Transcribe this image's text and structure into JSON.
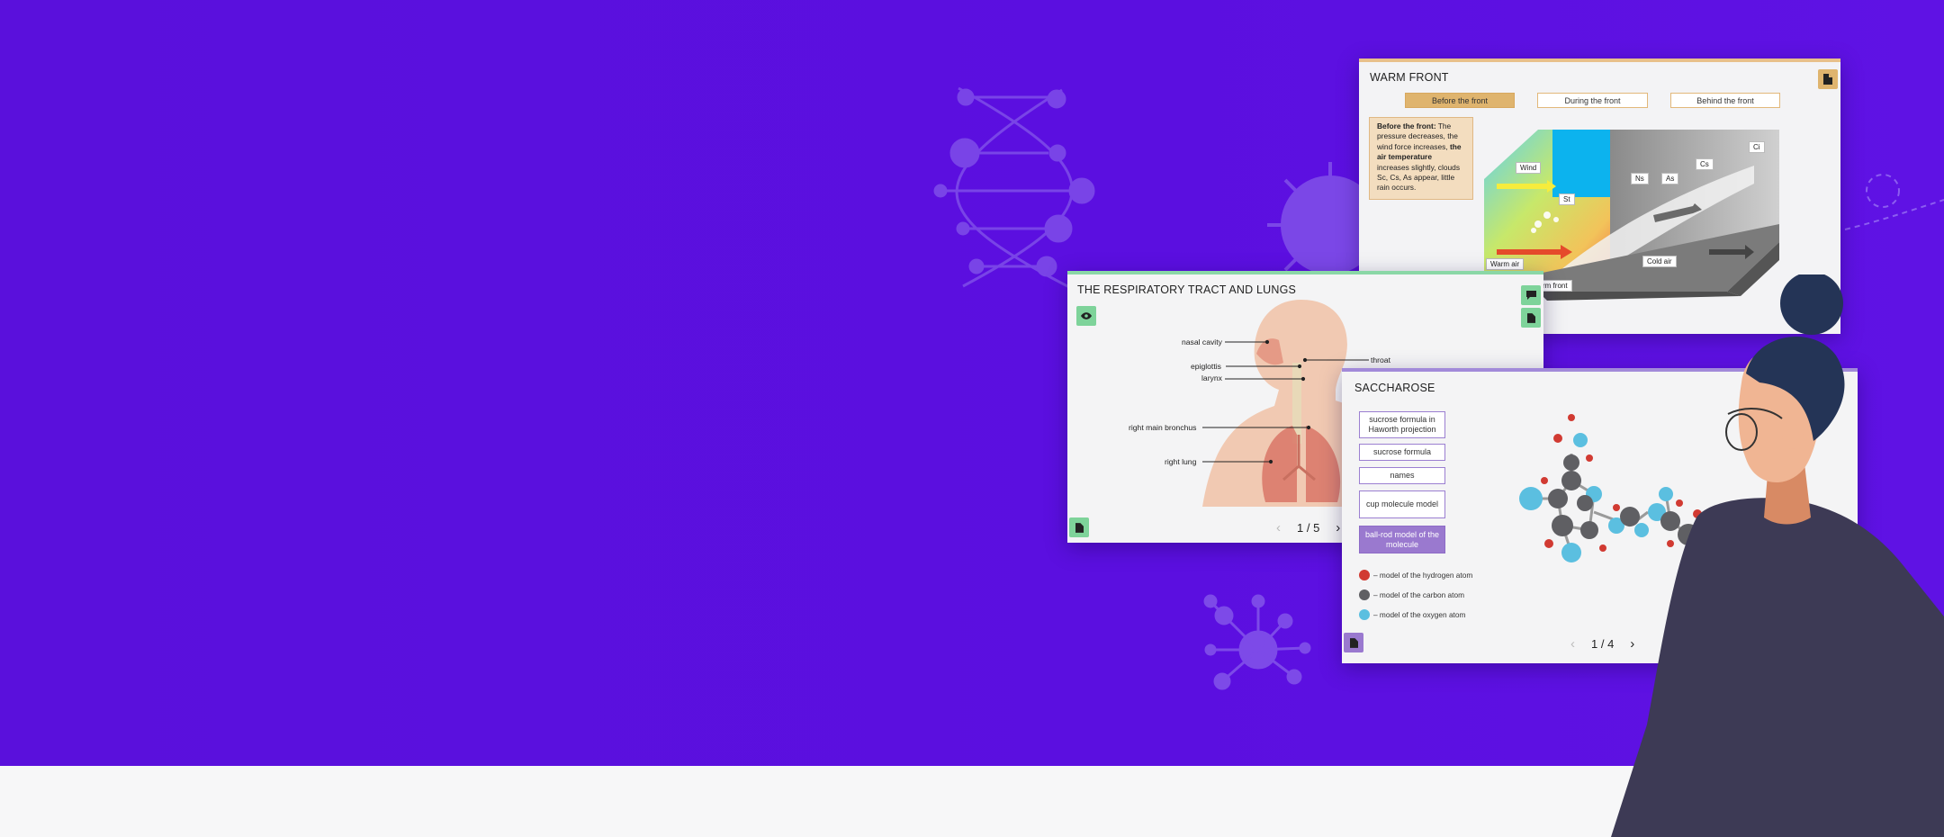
{
  "colors": {
    "hero_bg": "#5a10dc",
    "floor_bg": "#f7f7f8",
    "warm_accent": "#dfb46e",
    "green_accent": "#7ed39a",
    "purple_accent": "#9a79cf",
    "hydrogen": "#d13a32",
    "carbon": "#5f5f63",
    "oxygen": "#5bbfe0"
  },
  "warm_front": {
    "title": "WARM FRONT",
    "tabs": [
      {
        "label": "Before the front",
        "selected": true
      },
      {
        "label": "During the front",
        "selected": false
      },
      {
        "label": "Behind the front",
        "selected": false
      }
    ],
    "description_bold": "Before the front:",
    "description_text": " The pressure decreases, the wind force increases,",
    "description_bold2": "the air temperature",
    "description_text2": " increases slightly, clouds Sc, Cs, As appear, little rain occurs.",
    "labels": {
      "wind": "Wind",
      "st": "St",
      "ns": "Ns",
      "as": "As",
      "cs": "Cs",
      "ci": "Ci",
      "warm_air": "Warm air",
      "cold_air": "Cold air",
      "front": "rm front"
    },
    "doc_icon": "document-icon"
  },
  "respiratory": {
    "title": "THE RESPIRATORY TRACT AND LUNGS",
    "labels": {
      "nasal": "nasal cavity",
      "epiglottis": "epiglottis",
      "larynx": "larynx",
      "bronchus": "right main bronchus",
      "lung": "right lung",
      "throat": "throat"
    },
    "pager": {
      "prev": "‹",
      "text": "1 / 5",
      "next": "›"
    },
    "icons": {
      "eye": "eye-icon",
      "comment": "comment-icon",
      "doc": "document-icon",
      "doc_bottom": "document-icon"
    }
  },
  "saccharose": {
    "title": "SACCHAROSE",
    "buttons": [
      {
        "label": "sucrose formula in Haworth projection",
        "selected": false
      },
      {
        "label": "sucrose formula",
        "selected": false
      },
      {
        "label": "names",
        "selected": false
      },
      {
        "label": "cup molecule model",
        "selected": false
      },
      {
        "label": "ball-rod model of the molecule",
        "selected": true
      }
    ],
    "legend": [
      {
        "text": "– model of the hydrogen atom",
        "color": "#d13a32"
      },
      {
        "text": "– model of the carbon atom",
        "color": "#5f5f63"
      },
      {
        "text": "– model of the oxygen atom",
        "color": "#5bbfe0"
      }
    ],
    "pager": {
      "prev": "‹",
      "text": "1 / 4",
      "next": "›"
    },
    "icons": {
      "doc": "document-icon"
    }
  }
}
